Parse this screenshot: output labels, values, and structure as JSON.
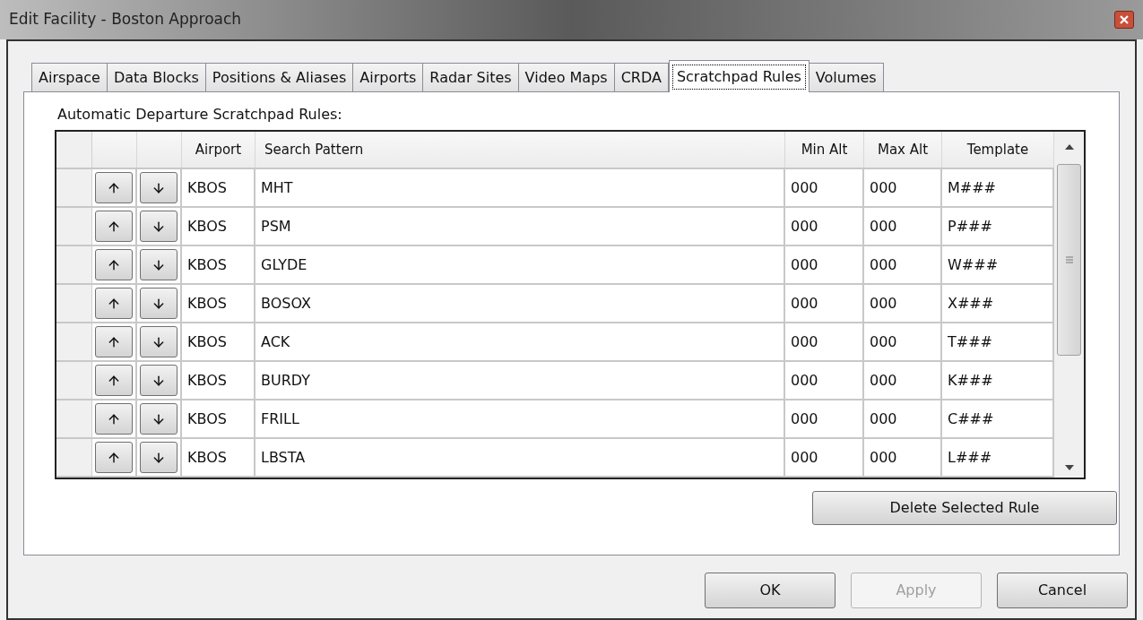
{
  "window": {
    "title": "Edit Facility - Boston Approach"
  },
  "tabs": [
    {
      "label": "Airspace",
      "selected": false
    },
    {
      "label": "Data Blocks",
      "selected": false
    },
    {
      "label": "Positions & Aliases",
      "selected": false
    },
    {
      "label": "Airports",
      "selected": false
    },
    {
      "label": "Radar Sites",
      "selected": false
    },
    {
      "label": "Video Maps",
      "selected": false
    },
    {
      "label": "CRDA",
      "selected": false
    },
    {
      "label": "Scratchpad Rules",
      "selected": true
    },
    {
      "label": "Volumes",
      "selected": false
    }
  ],
  "section_label": "Automatic Departure Scratchpad Rules:",
  "table": {
    "columns": [
      "Airport",
      "Search Pattern",
      "Min Alt",
      "Max Alt",
      "Template"
    ],
    "rows": [
      [
        "KBOS",
        "MHT",
        "000",
        "000",
        "M###"
      ],
      [
        "KBOS",
        "PSM",
        "000",
        "000",
        "P###"
      ],
      [
        "KBOS",
        "GLYDE",
        "000",
        "000",
        "W###"
      ],
      [
        "KBOS",
        "BOSOX",
        "000",
        "000",
        "X###"
      ],
      [
        "KBOS",
        "ACK",
        "000",
        "000",
        "T###"
      ],
      [
        "KBOS",
        "BURDY",
        "000",
        "000",
        "K###"
      ],
      [
        "KBOS",
        "FRILL",
        "000",
        "000",
        "C###"
      ],
      [
        "KBOS",
        "LBSTA",
        "000",
        "000",
        "L###"
      ]
    ]
  },
  "delete_button": "Delete Selected Rule",
  "buttons": [
    {
      "label": "OK",
      "disabled": false
    },
    {
      "label": "Apply",
      "disabled": true
    },
    {
      "label": "Cancel",
      "disabled": false
    }
  ]
}
